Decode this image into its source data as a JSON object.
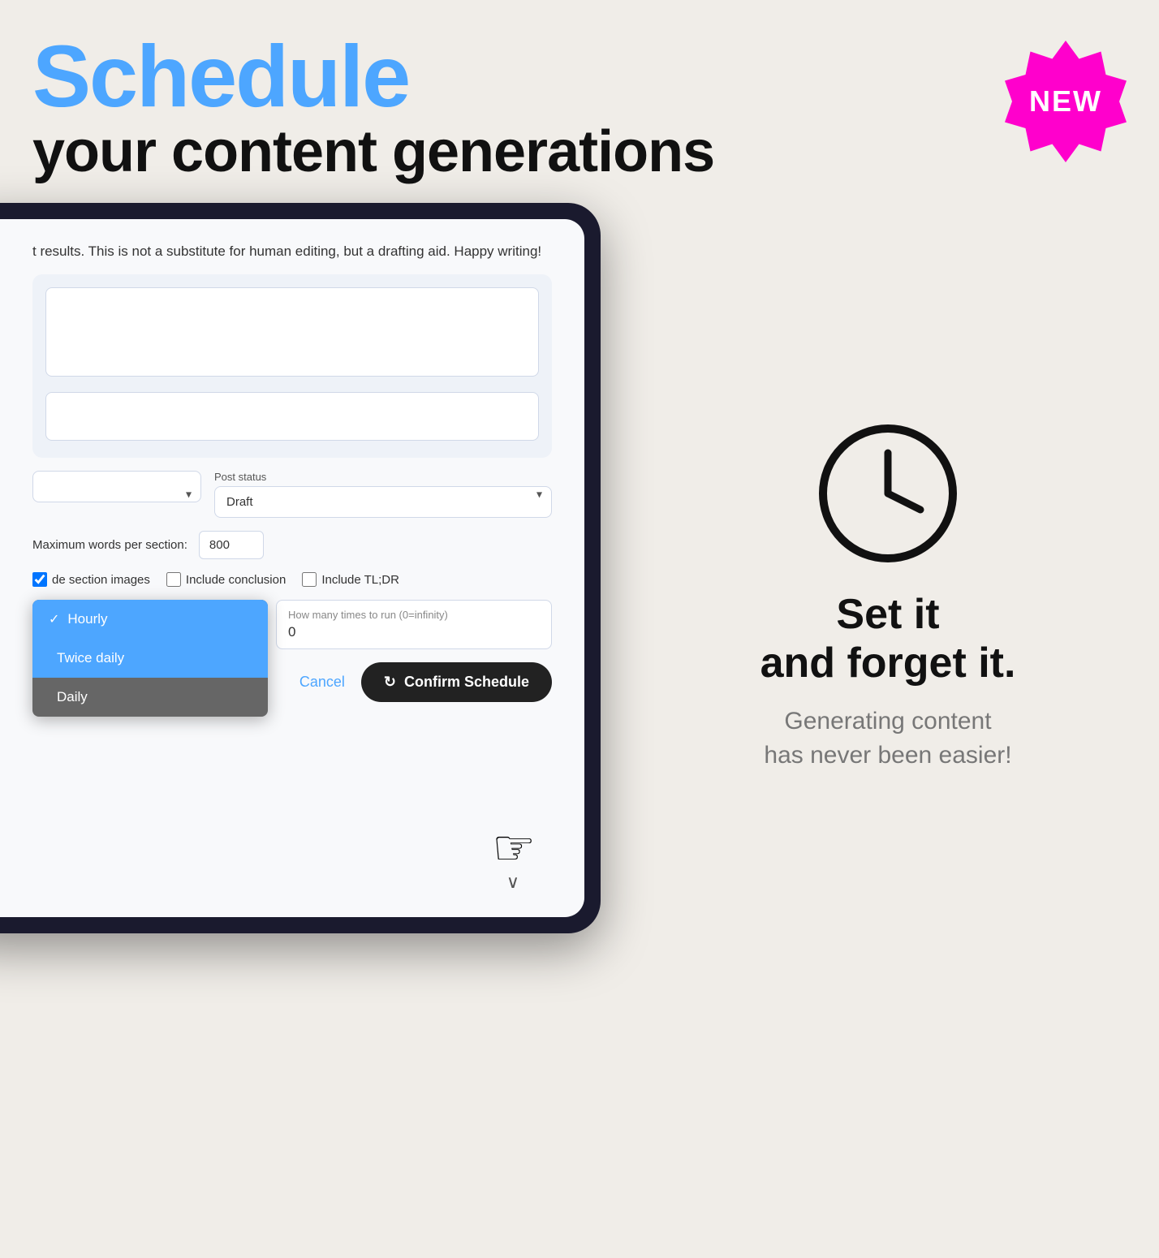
{
  "header": {
    "schedule_label": "Schedule",
    "subtitle": "your content generations"
  },
  "badge": {
    "text": "NEW"
  },
  "screen": {
    "disclaimer": "t results. This is not a substitute for human editing, but a drafting aid. Happy writing!",
    "post_status_label": "Post status",
    "post_status_value": "Draft",
    "max_words_label": "Maximum words per section:",
    "max_words_value": "800",
    "include_conclusion_label": "Include conclusion",
    "include_tldr_label": "Include TL;DR",
    "de_section_images_label": "de section images",
    "how_many_label": "How many times to run (0=infinity)",
    "how_many_value": "0",
    "cancel_label": "Cancel",
    "confirm_label": "Confirm Schedule"
  },
  "dropdown": {
    "items": [
      {
        "label": "Hourly",
        "selected": true
      },
      {
        "label": "Twice daily",
        "selected": false,
        "highlighted": true
      },
      {
        "label": "Daily",
        "selected": false
      }
    ]
  },
  "right_panel": {
    "set_it_line1": "Set it",
    "set_it_line2": "and forget it.",
    "subtext_line1": "Generating content",
    "subtext_line2": "has never been easier!"
  }
}
